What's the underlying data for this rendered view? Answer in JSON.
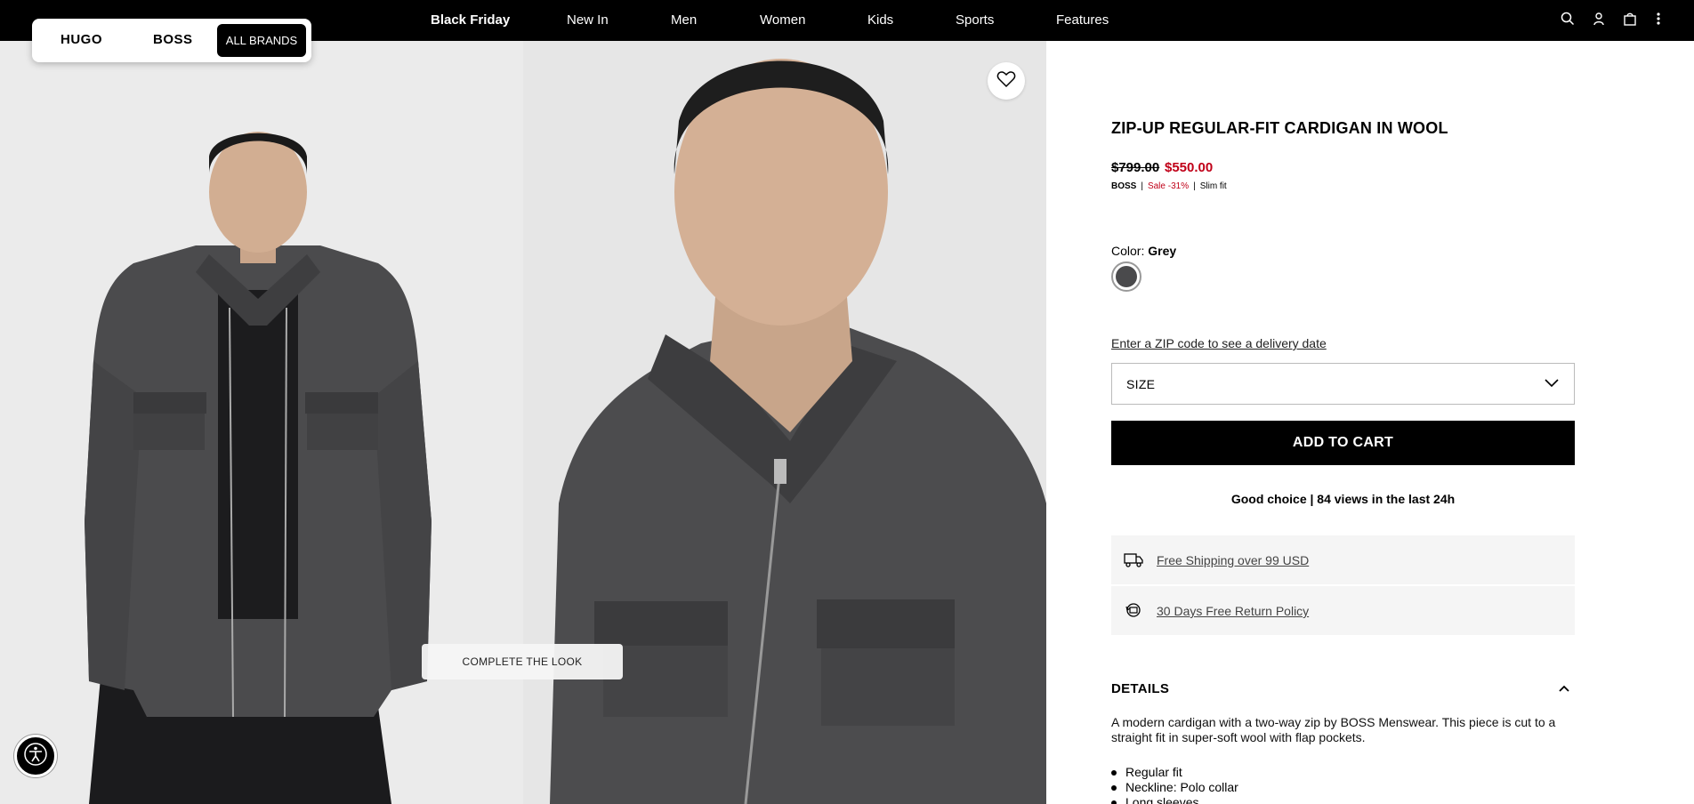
{
  "nav": {
    "items": [
      {
        "label": "Black Friday",
        "bold": true
      },
      {
        "label": "New In"
      },
      {
        "label": "Men"
      },
      {
        "label": "Women"
      },
      {
        "label": "Kids"
      },
      {
        "label": "Sports"
      },
      {
        "label": "Features"
      }
    ],
    "icons": [
      "search-icon",
      "account-icon",
      "bag-icon",
      "more-icon"
    ]
  },
  "brand_switcher": {
    "hugo": "HUGO",
    "boss": "BOSS",
    "all": "ALL BRANDS"
  },
  "gallery": {
    "complete_the_look": "COMPLETE THE LOOK"
  },
  "product": {
    "title": "ZIP-UP REGULAR-FIT CARDIGAN IN WOOL",
    "price_old": "$799.00",
    "price_new": "$550.00",
    "brand": "BOSS",
    "sale": "Sale -31%",
    "fit": "Slim fit",
    "color_label": "Color:",
    "color_value": "Grey",
    "swatch_color": "#4a4a4c",
    "zip_link": "Enter a ZIP code to see a delivery date",
    "size_label": "SIZE",
    "add_to_cart": "ADD TO CART",
    "views": "Good choice | 84 views in the last 24h",
    "perks": [
      {
        "icon": "truck-icon",
        "text": "Free Shipping over 99 USD"
      },
      {
        "icon": "return-icon",
        "text": "30 Days Free Return Policy"
      }
    ],
    "details_heading": "DETAILS",
    "description": "A modern cardigan with a two-way zip by BOSS Menswear. This piece is cut to a straight fit in super-soft wool with flap pockets.",
    "bullets": [
      "Regular fit",
      "Neckline: Polo collar",
      "Long sleeves"
    ]
  },
  "colors": {
    "sale_red": "#c00018",
    "nav_bg": "#000000"
  }
}
